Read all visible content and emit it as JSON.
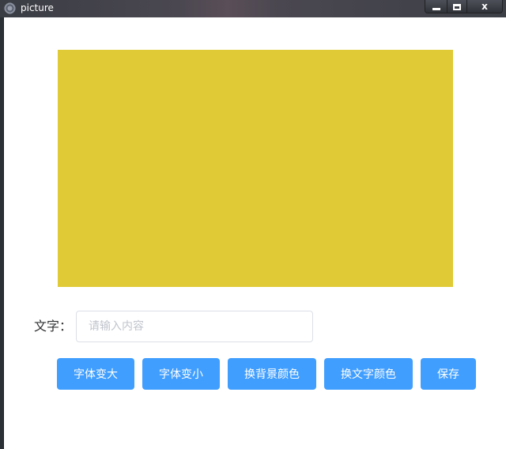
{
  "window": {
    "title": "picture",
    "minimize_glyph": "",
    "maximize_glyph": "",
    "close_glyph": "x"
  },
  "canvas": {
    "background_color": "#e0ca35",
    "text": ""
  },
  "form": {
    "label": "文字：",
    "input_value": "",
    "input_placeholder": "请输入内容"
  },
  "buttons": {
    "font_larger": "字体变大",
    "font_smaller": "字体变小",
    "change_bg_color": "换背景颜色",
    "change_text_color": "换文字颜色",
    "save": "保存"
  },
  "colors": {
    "accent": "#409eff",
    "canvas": "#e0ca35"
  }
}
